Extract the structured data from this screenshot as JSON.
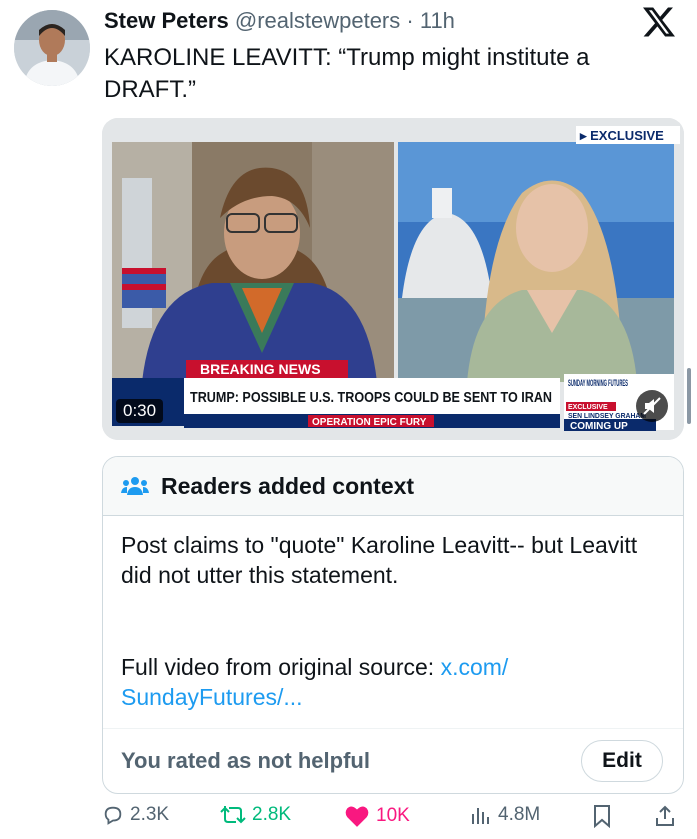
{
  "post": {
    "author_name": "Stew Peters",
    "author_handle": "@realstewpeters",
    "separator": "·",
    "time": "11h",
    "text": "KAROLINE LEAVITT: “Trump might institute a DRAFT.”"
  },
  "media": {
    "timer": "0:30",
    "breaking_label": "BREAKING NEWS",
    "headline": "TRUMP: POSSIBLE U.S. TROOPS COULD BE SENT TO IRAN",
    "ticker_label": "OPERATION EPIC FURY",
    "exclusive_tag": "▸ EXCLUSIVE",
    "show_name": "SUNDAY MORNING FUTURES",
    "show_exclusive": "EXCLUSIVE",
    "show_guest": "SEN LINDSEY GRAHAM",
    "coming_up": "COMING UP"
  },
  "context_note": {
    "title": "Readers added context",
    "body": "Post claims to \"quote\" Karoline Leavitt-- but Leavitt did not utter this statement.",
    "source_label": "Full video from original source: ",
    "source_link": "x.com/ SundayFutures/...",
    "rating_text": "You rated as not helpful",
    "edit_label": "Edit"
  },
  "actions": {
    "replies": "2.3K",
    "reposts": "2.8K",
    "likes": "10K",
    "views": "4.8M"
  },
  "colors": {
    "link": "#1d9bf0",
    "repost_green": "#00ba7c",
    "like_pink": "#f91880",
    "secondary_text": "#536471",
    "fox_red": "#c8102e",
    "fox_blue": "#0a2a6b"
  }
}
